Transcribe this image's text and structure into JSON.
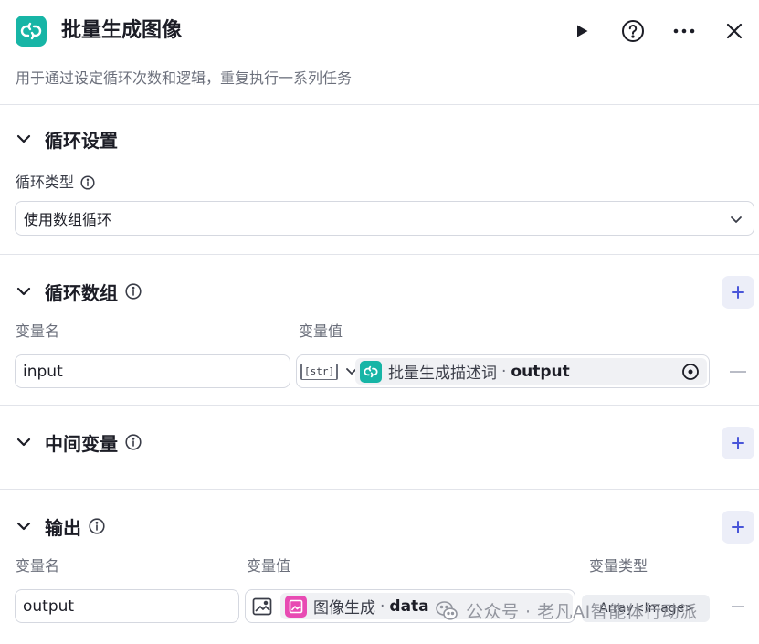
{
  "header": {
    "title": "批量生成图像",
    "description": "用于通过设定循环次数和逻辑，重复执行一系列任务",
    "icons": [
      "loop-icon",
      "play-icon",
      "help-icon",
      "more-icon",
      "close-icon"
    ],
    "accent_color": "#17b5a6"
  },
  "loop_settings": {
    "title": "循环设置",
    "type_label": "循环类型",
    "type_value": "使用数组循环"
  },
  "loop_array": {
    "title": "循环数组",
    "col_name": "变量名",
    "col_value": "变量值",
    "rows": [
      {
        "name": "input",
        "type_badge": "[str]",
        "ref_node": "批量生成描述词",
        "ref_sep": "·",
        "ref_var": "output"
      }
    ]
  },
  "intermediate": {
    "title": "中间变量"
  },
  "output": {
    "title": "输出",
    "col_name": "变量名",
    "col_value": "变量值",
    "col_type": "变量类型",
    "rows": [
      {
        "name": "output",
        "ref_node": "图像生成",
        "ref_sep": "·",
        "ref_var": "data",
        "type": "Array<Image>"
      }
    ],
    "image_node_color": "#e84bb3"
  },
  "watermark": {
    "text": "公众号 · 老凡AI智能体行动派"
  }
}
